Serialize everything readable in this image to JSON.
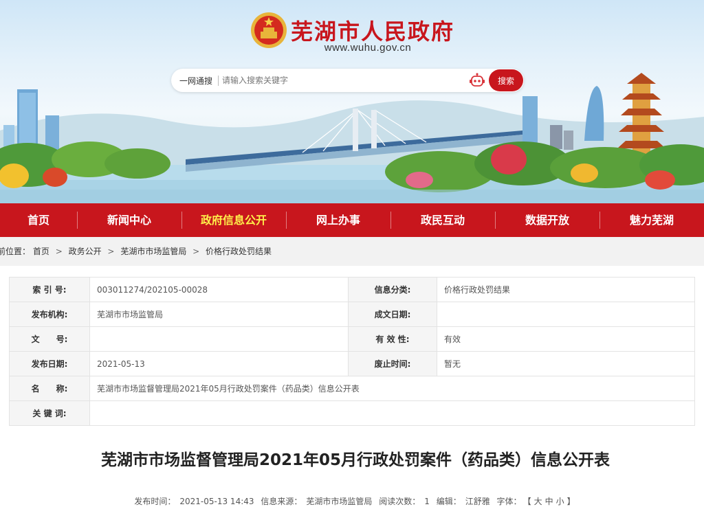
{
  "header": {
    "site_title": "芜湖市人民政府",
    "site_url": "www.wuhu.gov.cn"
  },
  "search": {
    "scope": "一网通搜",
    "placeholder": "请输入搜索关键字",
    "button": "搜索"
  },
  "nav": {
    "items": [
      "首页",
      "新闻中心",
      "政府信息公开",
      "网上办事",
      "政民互动",
      "数据开放",
      "魅力芜湖"
    ],
    "active_index": 2
  },
  "breadcrumb": {
    "label": "前位置：",
    "items": [
      "首页",
      "政务公开",
      "芜湖市市场监管局",
      "价格行政处罚结果"
    ],
    "sep": ">"
  },
  "info": {
    "index_label": "索 引 号:",
    "index_value": "003011274/202105-00028",
    "category_label": "信息分类:",
    "category_value": "价格行政处罚结果",
    "publisher_label": "发布机构:",
    "publisher_value": "芜湖市市场监管局",
    "written_date_label": "成文日期:",
    "written_date_value": "",
    "doc_no_label": "文　　号:",
    "doc_no_value": "",
    "validity_label": "有 效 性:",
    "validity_value": "有效",
    "publish_date_label": "发布日期:",
    "publish_date_value": "2021-05-13",
    "abolish_label": "废止时间:",
    "abolish_value": "暂无",
    "name_label": "名　　称:",
    "name_value": "芜湖市市场监督管理局2021年05月行政处罚案件（药品类）信息公开表",
    "keywords_label": "关 键 词:",
    "keywords_value": ""
  },
  "article": {
    "title": "芜湖市市场监督管理局2021年05月行政处罚案件（药品类）信息公开表",
    "meta": {
      "time_label": "发布时间：",
      "time_value": "2021-05-13 14:43",
      "source_label": "信息来源：",
      "source_value": "芜湖市市场监管局",
      "views_label": "阅读次数：",
      "views_value": "1",
      "editor_label": "编辑：",
      "editor_value": "江舒雅",
      "font_label": "字体：",
      "font_open": "【",
      "font_large": "大",
      "font_medium": "中",
      "font_small": "小",
      "font_close": "】"
    }
  },
  "colors": {
    "brand_red": "#c8161d",
    "nav_active": "#fff04a"
  }
}
